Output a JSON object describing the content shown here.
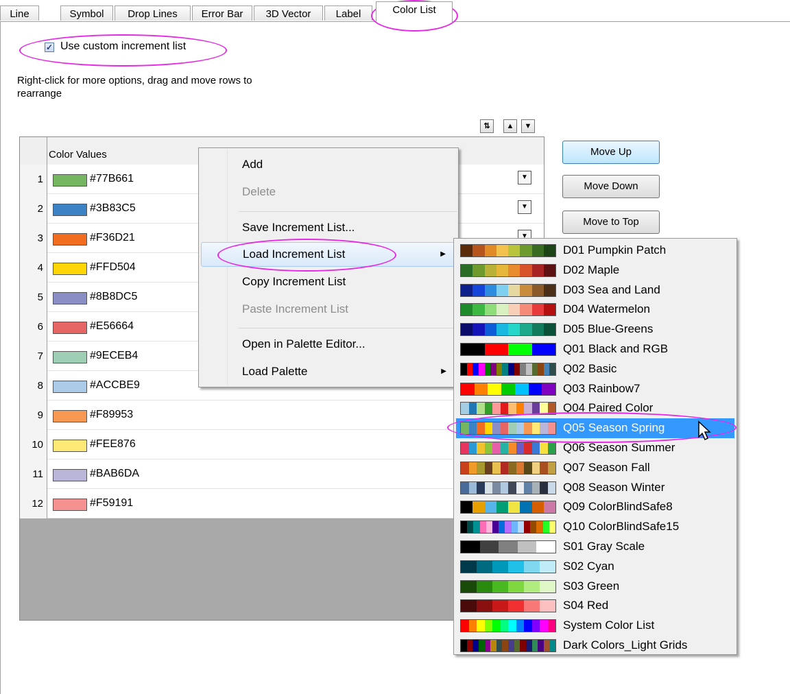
{
  "tabs": [
    "Line",
    "Symbol",
    "Drop Lines",
    "Error Bar",
    "3D Vector",
    "Label",
    "Color List"
  ],
  "active_tab": "Color List",
  "checkbox": {
    "label": "Use custom increment list",
    "checked": true
  },
  "info_text": "Right-click for more options, drag and move rows to  rearrange",
  "grid": {
    "header": "Color Values",
    "rows": [
      {
        "num": "1",
        "hex": "#77B661"
      },
      {
        "num": "2",
        "hex": "#3B83C5"
      },
      {
        "num": "3",
        "hex": "#F36D21"
      },
      {
        "num": "4",
        "hex": "#FFD504"
      },
      {
        "num": "5",
        "hex": "#8B8DC5"
      },
      {
        "num": "6",
        "hex": "#E56664"
      },
      {
        "num": "7",
        "hex": "#9ECEB4"
      },
      {
        "num": "8",
        "hex": "#ACCBE9"
      },
      {
        "num": "9",
        "hex": "#F89953"
      },
      {
        "num": "10",
        "hex": "#FEE876"
      },
      {
        "num": "11",
        "hex": "#BAB6DA"
      },
      {
        "num": "12",
        "hex": "#F59191"
      }
    ]
  },
  "buttons": {
    "move_up": "Move Up",
    "move_down": "Move Down",
    "move_top": "Move to Top"
  },
  "context_menu": [
    {
      "label": "Add",
      "disabled": false
    },
    {
      "label": "Delete",
      "disabled": true
    },
    {
      "label": "Save Increment List...",
      "disabled": false
    },
    {
      "label": "Load Increment List",
      "disabled": false,
      "submenu": true
    },
    {
      "label": "Copy Increment List",
      "disabled": false
    },
    {
      "label": "Paste Increment List",
      "disabled": true
    },
    {
      "label": "Open in Palette Editor...",
      "disabled": false
    },
    {
      "label": "Load Palette",
      "disabled": false,
      "submenu": true
    }
  ],
  "submenu": [
    {
      "label": "D01 Pumpkin Patch",
      "colors": [
        "#5b2a0a",
        "#b5541c",
        "#e08a28",
        "#f2c14e",
        "#b8c43c",
        "#6c9a2c",
        "#3a6b23",
        "#1d4416"
      ]
    },
    {
      "label": "D02 Maple",
      "colors": [
        "#2a6b25",
        "#6e9a2e",
        "#b9b238",
        "#e5b73b",
        "#e98c2f",
        "#d9532a",
        "#a82424",
        "#5d1111"
      ]
    },
    {
      "label": "D03 Sea and Land",
      "colors": [
        "#0d1f8a",
        "#1544d8",
        "#2d8ce0",
        "#7fd0f0",
        "#e6d8a0",
        "#c98c3c",
        "#8a5a2a",
        "#4b2f18"
      ]
    },
    {
      "label": "D04 Watermelon",
      "colors": [
        "#1e8a2a",
        "#3cb843",
        "#8fdc7b",
        "#d9f0c0",
        "#f8d0b8",
        "#f58c7a",
        "#e83a3a",
        "#b51010"
      ]
    },
    {
      "label": "D05 Blue-Greens",
      "colors": [
        "#0a0a6b",
        "#1414b8",
        "#0d5cd8",
        "#1ab8e0",
        "#26d6c8",
        "#1ca88a",
        "#127a5c",
        "#0b5038"
      ]
    },
    {
      "label": "Q01 Black and RGB",
      "colors": [
        "#000000",
        "#ff0000",
        "#00ff00",
        "#0000ff"
      ]
    },
    {
      "label": "Q02 Basic",
      "colors": [
        "#000000",
        "#ff0000",
        "#0000ff",
        "#ff00ff",
        "#008000",
        "#800080",
        "#808000",
        "#008080",
        "#000080",
        "#800000",
        "#808080",
        "#c0c0c0",
        "#556b2f",
        "#8b4513",
        "#4682b4",
        "#2f4f4f"
      ]
    },
    {
      "label": "Q03 Rainbow7",
      "colors": [
        "#ff0000",
        "#ff8000",
        "#ffff00",
        "#00cc00",
        "#00c0ff",
        "#0000ff",
        "#8000c0"
      ]
    },
    {
      "label": "Q04 Paired Color",
      "colors": [
        "#a6cee3",
        "#1f78b4",
        "#b2df8a",
        "#33a02c",
        "#fb9a99",
        "#e31a1c",
        "#fdbf6f",
        "#ff7f00",
        "#cab2d6",
        "#6a3d9a",
        "#ffff99",
        "#b15928"
      ]
    },
    {
      "label": "Q05 Season Spring",
      "colors": [
        "#77B661",
        "#3B83C5",
        "#F36D21",
        "#FFD504",
        "#8B8DC5",
        "#E56664",
        "#9ECEB4",
        "#ACCBE9",
        "#F89953",
        "#FEE876",
        "#BAB6DA",
        "#F59191"
      ]
    },
    {
      "label": "Q06 Season Summer",
      "colors": [
        "#e8355f",
        "#2a9ad6",
        "#f0c22c",
        "#8ac53a",
        "#e65fa8",
        "#26b3a3",
        "#f58a28",
        "#6a5bc6",
        "#d82a2a",
        "#3a7ad6",
        "#f5e040",
        "#2aa04a"
      ]
    },
    {
      "label": "Q07 Season Fall",
      "colors": [
        "#c8411a",
        "#f09a2a",
        "#a89830",
        "#6a4020",
        "#e8c050",
        "#b02a20",
        "#8a6a20",
        "#d87830",
        "#584818",
        "#f0d080",
        "#a85020",
        "#c0a040"
      ]
    },
    {
      "label": "Q08 Season Winter",
      "colors": [
        "#4a6a9a",
        "#9ab8d8",
        "#2a3a5a",
        "#d8e0e8",
        "#7a8aa0",
        "#b0c8e0",
        "#404858",
        "#e8ecf0",
        "#6080a8",
        "#a8b0b8",
        "#283040",
        "#c8d8e8"
      ]
    },
    {
      "label": "Q09 ColorBlindSafe8",
      "colors": [
        "#000000",
        "#e69f00",
        "#56b4e9",
        "#009e73",
        "#f0e442",
        "#0072b2",
        "#d55e00",
        "#cc79a7"
      ]
    },
    {
      "label": "Q10 ColorBlindSafe15",
      "colors": [
        "#000000",
        "#004949",
        "#009292",
        "#ff6db6",
        "#ffb6db",
        "#490092",
        "#006ddb",
        "#b66dff",
        "#6db6ff",
        "#b6dbff",
        "#920000",
        "#924900",
        "#db6d00",
        "#24ff24",
        "#ffff6d"
      ]
    },
    {
      "label": "S01 Gray Scale",
      "colors": [
        "#000000",
        "#404040",
        "#808080",
        "#c0c0c0",
        "#ffffff"
      ]
    },
    {
      "label": "S02 Cyan",
      "colors": [
        "#003a4a",
        "#006a80",
        "#0098b8",
        "#20c0e8",
        "#80d8f0",
        "#c0ecf8"
      ]
    },
    {
      "label": "S03 Green",
      "colors": [
        "#1a4a0a",
        "#2a8a10",
        "#4ab820",
        "#80d840",
        "#b0ec80",
        "#e0f8c8"
      ]
    },
    {
      "label": "S04 Red",
      "colors": [
        "#4a0a0a",
        "#8a1010",
        "#c81818",
        "#f03030",
        "#f87878",
        "#fcc0c0"
      ]
    },
    {
      "label": "System Color List",
      "colors": [
        "#ff0000",
        "#ff8000",
        "#ffff00",
        "#80ff00",
        "#00ff00",
        "#00ff80",
        "#00ffff",
        "#0080ff",
        "#0000ff",
        "#8000ff",
        "#ff00ff",
        "#ff0080"
      ]
    },
    {
      "label": "Dark Colors_Light Grids",
      "colors": [
        "#000000",
        "#8b0000",
        "#00008b",
        "#006400",
        "#8b008b",
        "#b8860b",
        "#2f4f4f",
        "#8b4513",
        "#483d8b",
        "#556b2f",
        "#800000",
        "#191970",
        "#2e8b57",
        "#4b0082",
        "#a0522d",
        "#008b8b"
      ]
    }
  ],
  "hover_submenu_index": 9
}
